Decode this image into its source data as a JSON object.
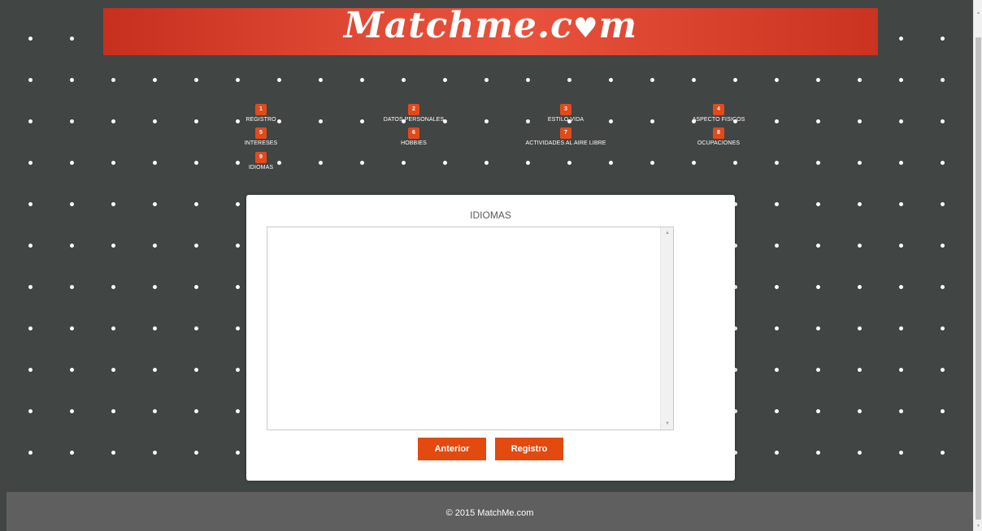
{
  "header": {
    "logo_main": "Matchme",
    "logo_dot": ".c",
    "logo_heart": "♥",
    "logo_end": "m"
  },
  "steps": [
    {
      "number": "1",
      "label": "REGISTRO"
    },
    {
      "number": "2",
      "label": "DATOS PERSONALES"
    },
    {
      "number": "3",
      "label": "ESTILO VIDA"
    },
    {
      "number": "4",
      "label": "ASPECTO FISICOS"
    },
    {
      "number": "5",
      "label": "INTERESES"
    },
    {
      "number": "6",
      "label": "HOBBIES"
    },
    {
      "number": "7",
      "label": "ACTIVIDADES AL AIRE LIBRE"
    },
    {
      "number": "8",
      "label": "OCUPACIONES"
    },
    {
      "number": "9",
      "label": "IDIOMAS"
    }
  ],
  "panel": {
    "title": "IDIOMAS",
    "textarea_value": "",
    "scroll_up_glyph": "▲",
    "scroll_down_glyph": "▼"
  },
  "buttons": {
    "previous_label": "Anterior",
    "submit_label": "Registro"
  },
  "footer": {
    "text": "© 2015 MatchMe.com"
  },
  "page_scrollbar": {
    "up_glyph": "▲",
    "down_glyph": "▼"
  },
  "colors": {
    "background": "#414544",
    "header_red": "#e14b35",
    "accent_orange": "#e24a10",
    "footer": "#5f5f5f"
  }
}
